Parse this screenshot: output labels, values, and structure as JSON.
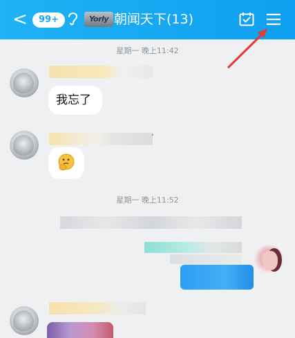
{
  "header": {
    "back_label": "<",
    "unread_badge": "99+",
    "group_logo_text": "Yorly",
    "group_title": "朝闻天下(13)"
  },
  "messages": [
    {
      "timestamp": "星期一 晚上11:42"
    },
    {
      "text": "我忘了"
    },
    {
      "emoji": "thinking-face-emoji"
    },
    {
      "timestamp": "星期一 晚上11:52"
    }
  ],
  "colors": {
    "header": "#12a5f2",
    "annotation_arrow": "#e53935",
    "my_bubble": "#2f9ff2"
  },
  "icons": [
    "back-icon",
    "ear-icon",
    "calendar-check-icon",
    "menu-icon"
  ]
}
